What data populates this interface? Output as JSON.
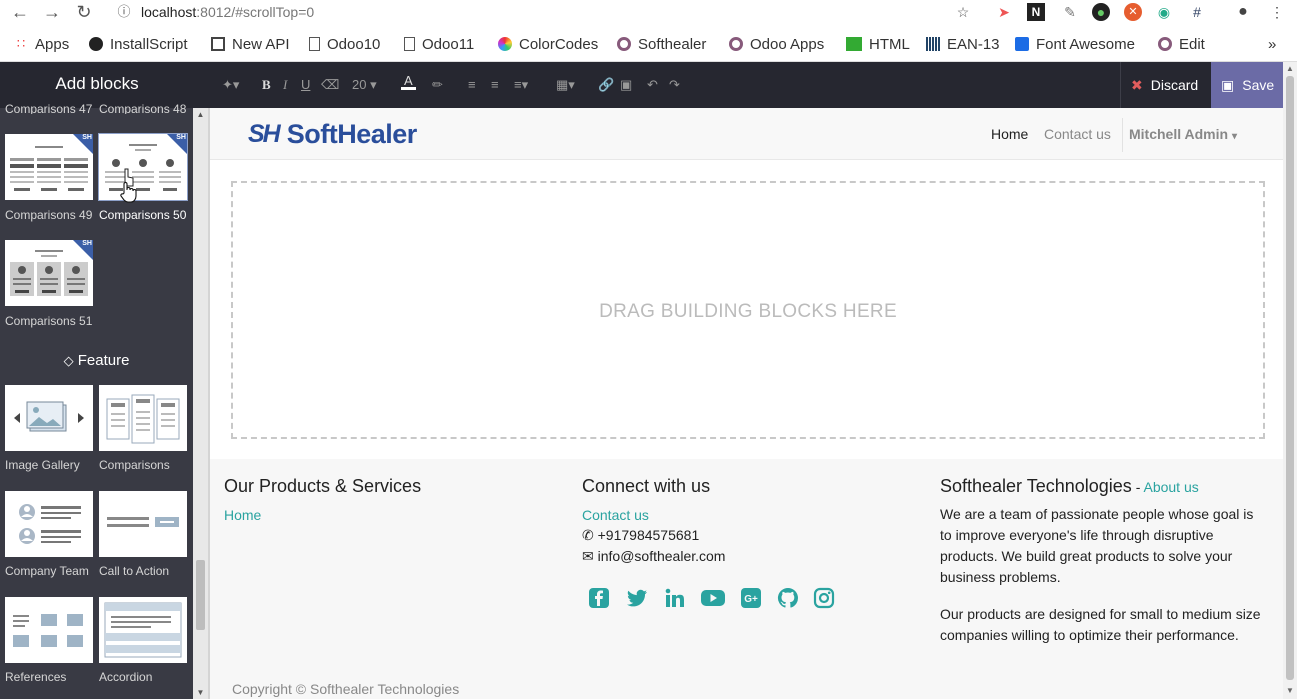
{
  "browser": {
    "url_host": "localhost",
    "url_path": ":8012/#scrollTop=0",
    "bookmarks": [
      {
        "label": "Apps",
        "icon": "apps-grid-icon"
      },
      {
        "label": "InstallScript",
        "icon": "github-icon"
      },
      {
        "label": "New API",
        "icon": "book-icon"
      },
      {
        "label": "Odoo10",
        "icon": "page-icon"
      },
      {
        "label": "Odoo11",
        "icon": "page-icon"
      },
      {
        "label": "ColorCodes",
        "icon": "colorwheel-icon"
      },
      {
        "label": "Softhealer",
        "icon": "odoo-circle-icon"
      },
      {
        "label": "Odoo Apps",
        "icon": "odoo-circle-icon"
      },
      {
        "label": "HTML",
        "icon": "html-icon"
      },
      {
        "label": "EAN-13",
        "icon": "barcode-icon"
      },
      {
        "label": "Font Awesome",
        "icon": "flag-icon"
      },
      {
        "label": "Edit",
        "icon": "odoo-circle-icon"
      }
    ]
  },
  "sidebar": {
    "title": "Add blocks",
    "blocks": [
      {
        "label": "Comparisons 47"
      },
      {
        "label": "Comparisons 48"
      },
      {
        "label": "Comparisons 49"
      },
      {
        "label": "Comparisons 50"
      },
      {
        "label": "Comparisons 51"
      }
    ],
    "section_title": "Feature",
    "feature_blocks": [
      {
        "label": "Image Gallery"
      },
      {
        "label": "Comparisons"
      },
      {
        "label": "Company Team"
      },
      {
        "label": "Call to Action"
      },
      {
        "label": "References"
      },
      {
        "label": "Accordion"
      }
    ],
    "badge": "SH"
  },
  "toolbar": {
    "font_size": "20",
    "discard_label": "Discard",
    "save_label": "Save"
  },
  "header": {
    "logo_mark": "SH",
    "logo_text": "SoftHealer",
    "nav_home": "Home",
    "nav_contact": "Contact us",
    "user_name": "Mitchell Admin"
  },
  "dropzone": {
    "text": "DRAG BUILDING BLOCKS HERE"
  },
  "footer": {
    "col1_title": "Our Products & Services",
    "col1_link": "Home",
    "col2_title": "Connect with us",
    "col2_link": "Contact us",
    "phone": "+917984575681",
    "email": "info@softhealer.com",
    "col3_title": "Softhealer Technologies",
    "col3_sep": " - ",
    "col3_link": "About us",
    "para1": "We are a team of passionate people whose goal is to improve everyone's life through disruptive products. We build great products to solve your business problems.",
    "para2": "Our products are designed for small to medium size companies willing to optimize their performance.",
    "copyright": "Copyright © Softhealer Technologies"
  },
  "colors": {
    "accent": "#2aa3a0",
    "brand": "#2a4e9b",
    "sidebar_bg": "#393a44",
    "save_bg": "#6b6ba6"
  }
}
